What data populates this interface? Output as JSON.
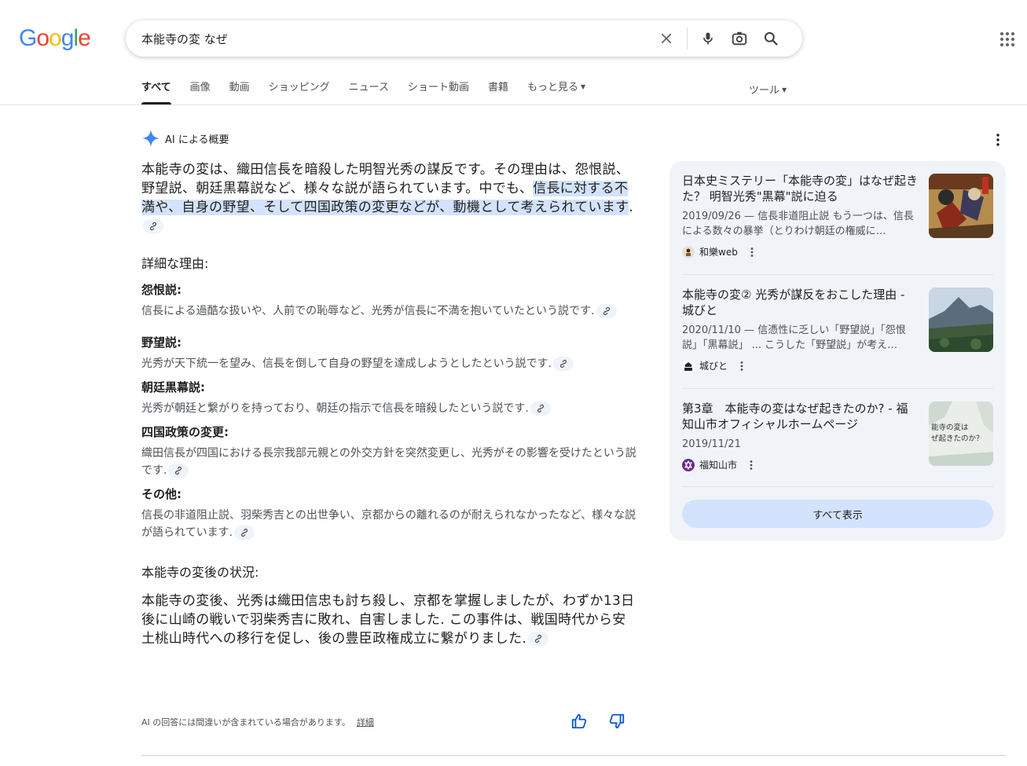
{
  "logo": {
    "letters": [
      "G",
      "o",
      "o",
      "g",
      "l",
      "e"
    ],
    "colors": [
      "#4285F4",
      "#EA4335",
      "#FBBC05",
      "#4285F4",
      "#34A853",
      "#EA4335"
    ]
  },
  "search": {
    "query": "本能寺の変 なぜ"
  },
  "tabs": [
    {
      "label": "すべて",
      "active": true
    },
    {
      "label": "画像"
    },
    {
      "label": "動画"
    },
    {
      "label": "ショッピング"
    },
    {
      "label": "ニュース"
    },
    {
      "label": "ショート動画"
    },
    {
      "label": "書籍"
    },
    {
      "label": "もっと見る"
    }
  ],
  "tools_label": "ツール",
  "ai": {
    "header": "AI による概要",
    "lead_plain": "本能寺の変は、織田信長を暗殺した明智光秀の謀反です。その理由は、怨恨説、野望説、朝廷黒幕説など、様々な説が語られています。中でも、",
    "lead_highlight": "信長に対する不満や、自身の野望、そして四国政策の変更などが、動機として考えられています",
    "lead_end": ".",
    "detail_heading": "詳細な理由:",
    "reasons": [
      {
        "title": "怨恨説:",
        "text": "信長による過酷な扱いや、人前での恥辱など、光秀が信長に不満を抱いていたという説です."
      },
      {
        "title": "野望説:",
        "text": "光秀が天下統一を望み、信長を倒して自身の野望を達成しようとしたという説です."
      },
      {
        "title": "朝廷黒幕説:",
        "text": "光秀が朝廷と繋がりを持っており、朝廷の指示で信長を暗殺したという説です."
      },
      {
        "title": "四国政策の変更:",
        "text": "織田信長が四国における長宗我部元親との外交方針を突然変更し、光秀がその影響を受けたという説です."
      },
      {
        "title": "その他:",
        "text": "信長の非道阻止説、羽柴秀吉との出世争い、京都からの離れるのが耐えられなかったなど、様々な説が語られています."
      }
    ],
    "after_heading": "本能寺の変後の状況:",
    "after_text": "本能寺の変後、光秀は織田信忠も討ち殺し、京都を掌握しましたが、わずか13日後に山崎の戦いで羽柴秀吉に敗れ、自害しました. この事件は、戦国時代から安土桃山時代への移行を促し、後の豊臣政権成立に繋がりました.",
    "disclaimer": "AI の回答には間違いが含まれている場合があります。",
    "details_link": "詳細"
  },
  "sources": [
    {
      "title": "日本史ミステリー「本能寺の変」はなぜ起きた？ 明智光秀\"黒幕\"説に迫る",
      "snippet": "2019/09/26 — 信長非道阻止説 もう一つは、信長による数々の暴挙（とりわけ朝廷の権威に…",
      "site": "和樂web"
    },
    {
      "title": "本能寺の変② 光秀が謀反をおこした理由 - 城びと",
      "snippet": "2020/11/10 — 信憑性に乏しい「野望説」「怨恨説」「黒幕説」 ... こうした「野望説」が考え…",
      "site": "城びと"
    },
    {
      "title": "第3章　本能寺の変はなぜ起きたのか? - 福知山市オフィシャルホームページ",
      "snippet": "2019/11/21",
      "site": "福知山市",
      "thumb_text": "能寺の変は ぜ起きたのか？"
    }
  ],
  "show_all": "すべて表示"
}
